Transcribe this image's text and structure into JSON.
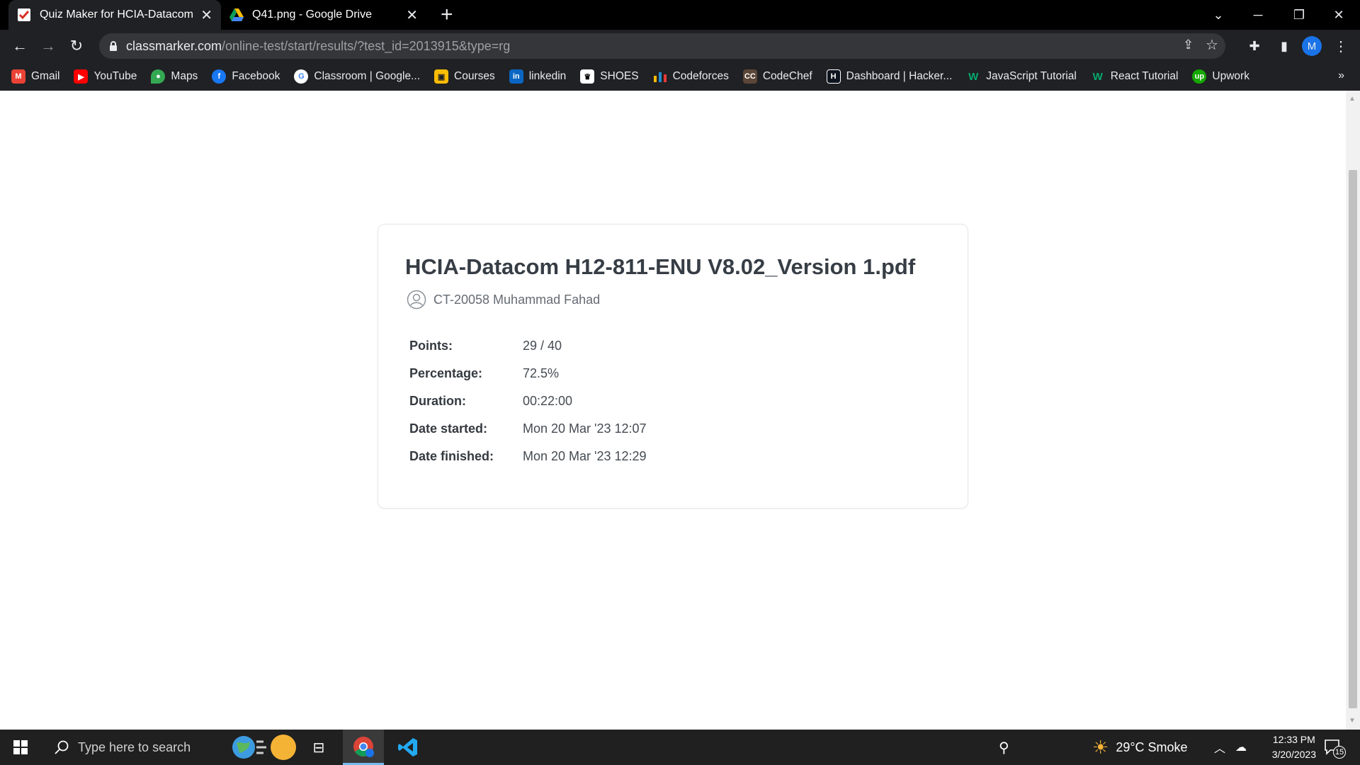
{
  "browser": {
    "tabs": [
      {
        "title": "Quiz Maker for HCIA-Datacom H",
        "active": true,
        "icon": "classmarker-icon"
      },
      {
        "title": "Q41.png - Google Drive",
        "active": false,
        "icon": "google-drive-icon"
      }
    ],
    "new_tab_symbol": "+",
    "url_domain": "classmarker.com",
    "url_path": "/online-test/start/results/?test_id=2013915&type=rg",
    "profile_initial": "M"
  },
  "bookmarks": [
    {
      "label": "Gmail",
      "icon": "gmail-icon",
      "color": "#ea4335"
    },
    {
      "label": "YouTube",
      "icon": "youtube-icon",
      "color": "#ff0000"
    },
    {
      "label": "Maps",
      "icon": "maps-icon",
      "color": "#34a853"
    },
    {
      "label": "Facebook",
      "icon": "facebook-icon",
      "color": "#1877f2"
    },
    {
      "label": "Classroom | Google...",
      "icon": "google-icon",
      "color": "#ffffff"
    },
    {
      "label": "Courses",
      "icon": "courses-icon",
      "color": "#fbbc04"
    },
    {
      "label": "linkedin",
      "icon": "linkedin-icon",
      "color": "#0a66c2"
    },
    {
      "label": "SHOES",
      "icon": "shoes-icon",
      "color": "#ffffff"
    },
    {
      "label": "Codeforces",
      "icon": "codeforces-icon",
      "color": "#1f8acb"
    },
    {
      "label": "CodeChef",
      "icon": "codechef-icon",
      "color": "#5b4638"
    },
    {
      "label": "Dashboard | Hacker...",
      "icon": "hackerrank-icon",
      "color": "#0e141e"
    },
    {
      "label": "JavaScript Tutorial",
      "icon": "w3schools-icon",
      "color": "#04aa6d"
    },
    {
      "label": "React Tutorial",
      "icon": "w3schools-icon",
      "color": "#04aa6d"
    },
    {
      "label": "Upwork",
      "icon": "upwork-icon",
      "color": "#14a800"
    }
  ],
  "bookmarks_more": "»",
  "result": {
    "title": "HCIA-Datacom H12-811-ENU V8.02_Version 1.pdf",
    "user": "CT-20058 Muhammad Fahad",
    "stats": [
      {
        "label": "Points:",
        "value": "29 / 40"
      },
      {
        "label": "Percentage:",
        "value": "72.5%"
      },
      {
        "label": "Duration:",
        "value": "00:22:00"
      },
      {
        "label": "Date started:",
        "value": "Mon 20 Mar '23 12:07"
      },
      {
        "label": "Date finished:",
        "value": "Mon 20 Mar '23 12:29"
      }
    ]
  },
  "taskbar": {
    "search_placeholder": "Type here to search",
    "weather": "29°C  Smoke",
    "time": "12:33 PM",
    "date": "3/20/2023",
    "notification_count": "15"
  }
}
